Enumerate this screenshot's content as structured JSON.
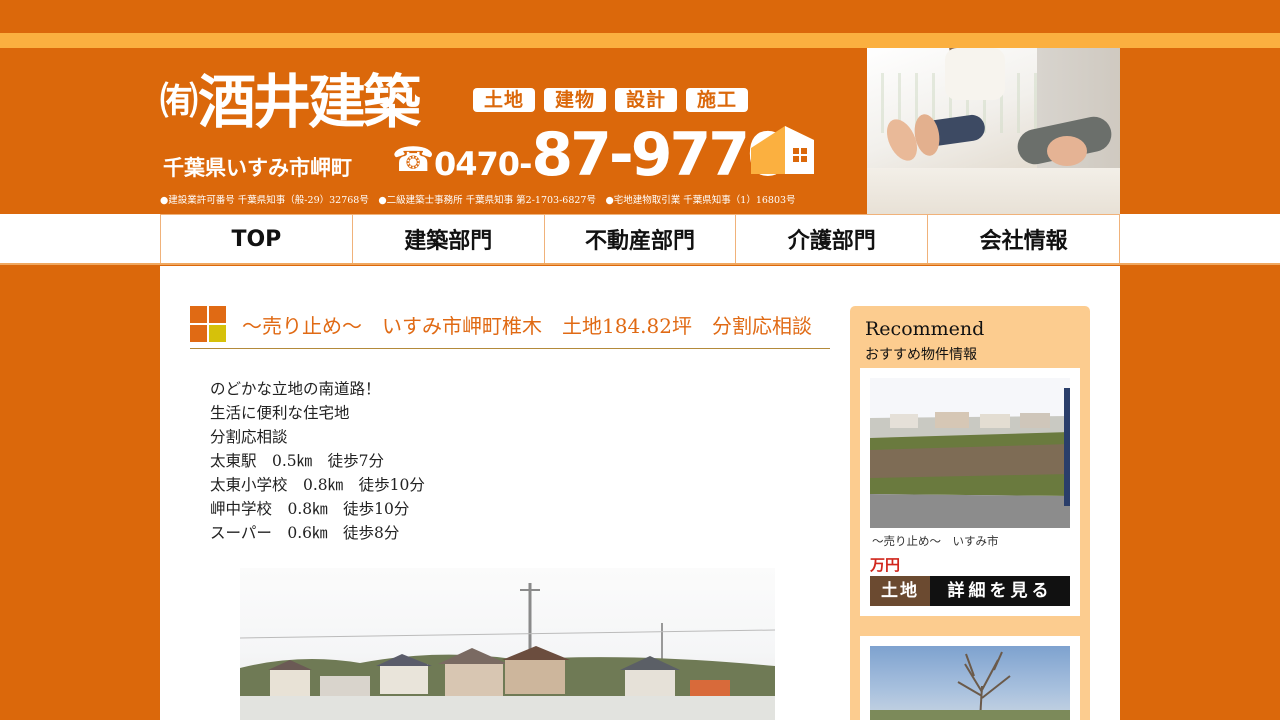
{
  "header": {
    "company_prefix": "㈲",
    "company_name": "酒井建築",
    "tags": [
      "土地",
      "建物",
      "設計",
      "施工"
    ],
    "location": "千葉県いすみ市岬町",
    "phone_icon": "☎",
    "phone_prefix": "0470-",
    "phone_main": "87-9770",
    "licenses": "●建設業許可番号 千葉県知事（般-29）32768号　●二級建築士事務所 千葉県知事 第2-1703-6827号　●宅地建物取引業 千葉県知事（1）16803号",
    "brand_color": "#db680b",
    "accent_color": "#fbb040"
  },
  "nav": {
    "items": [
      "TOP",
      "建築部門",
      "不動産部門",
      "介護部門",
      "会社情報"
    ]
  },
  "main": {
    "title": "～売り止め～　いすみ市岬町椎木　土地184.82坪　分割応相談",
    "title_color": "#e06a14",
    "description": [
      "のどかな立地の南道路！",
      "生活に便利な住宅地",
      "分割応相談",
      "太東駅　0.5㎞　徒歩7分",
      "太東小学校　0.8㎞　徒歩10分",
      "岬中学校　0.8㎞　徒歩10分",
      "スーパー　0.6㎞　徒歩8分"
    ]
  },
  "sidebar": {
    "title": "Recommend",
    "subtitle": "おすすめ物件情報",
    "cards": [
      {
        "text": "～売り止め～　いすみ市",
        "price": "万円",
        "category": "土地",
        "detail_label": "詳細を見る"
      }
    ]
  }
}
